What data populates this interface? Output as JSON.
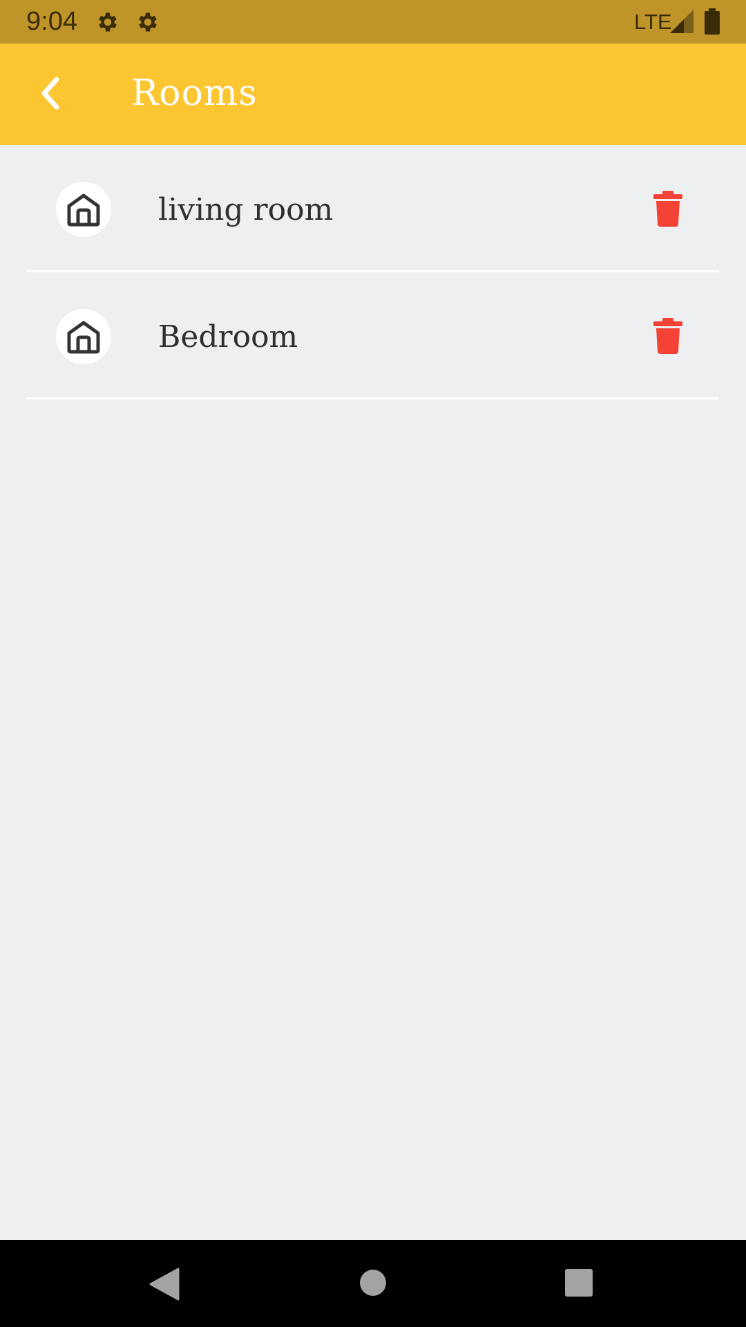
{
  "status_bar": {
    "time": "9:04",
    "network": "LTE",
    "icons": [
      "gear-icon",
      "gear-icon",
      "signal-icon",
      "battery-icon"
    ]
  },
  "app_bar": {
    "title": "Rooms",
    "back_icon": "chevron-left-icon",
    "background_color": "#FBC632"
  },
  "rooms": [
    {
      "name": "living room",
      "icon": "home-icon",
      "action_icon": "trash-icon"
    },
    {
      "name": "Bedroom",
      "icon": "home-icon",
      "action_icon": "trash-icon"
    }
  ],
  "nav_bar": {
    "icons": [
      "back-triangle-icon",
      "home-circle-icon",
      "recents-square-icon"
    ]
  },
  "colors": {
    "status_bar": "#BF9428",
    "accent": "#FBC632",
    "delete": "#F44336",
    "background": "#EEEFF1"
  }
}
